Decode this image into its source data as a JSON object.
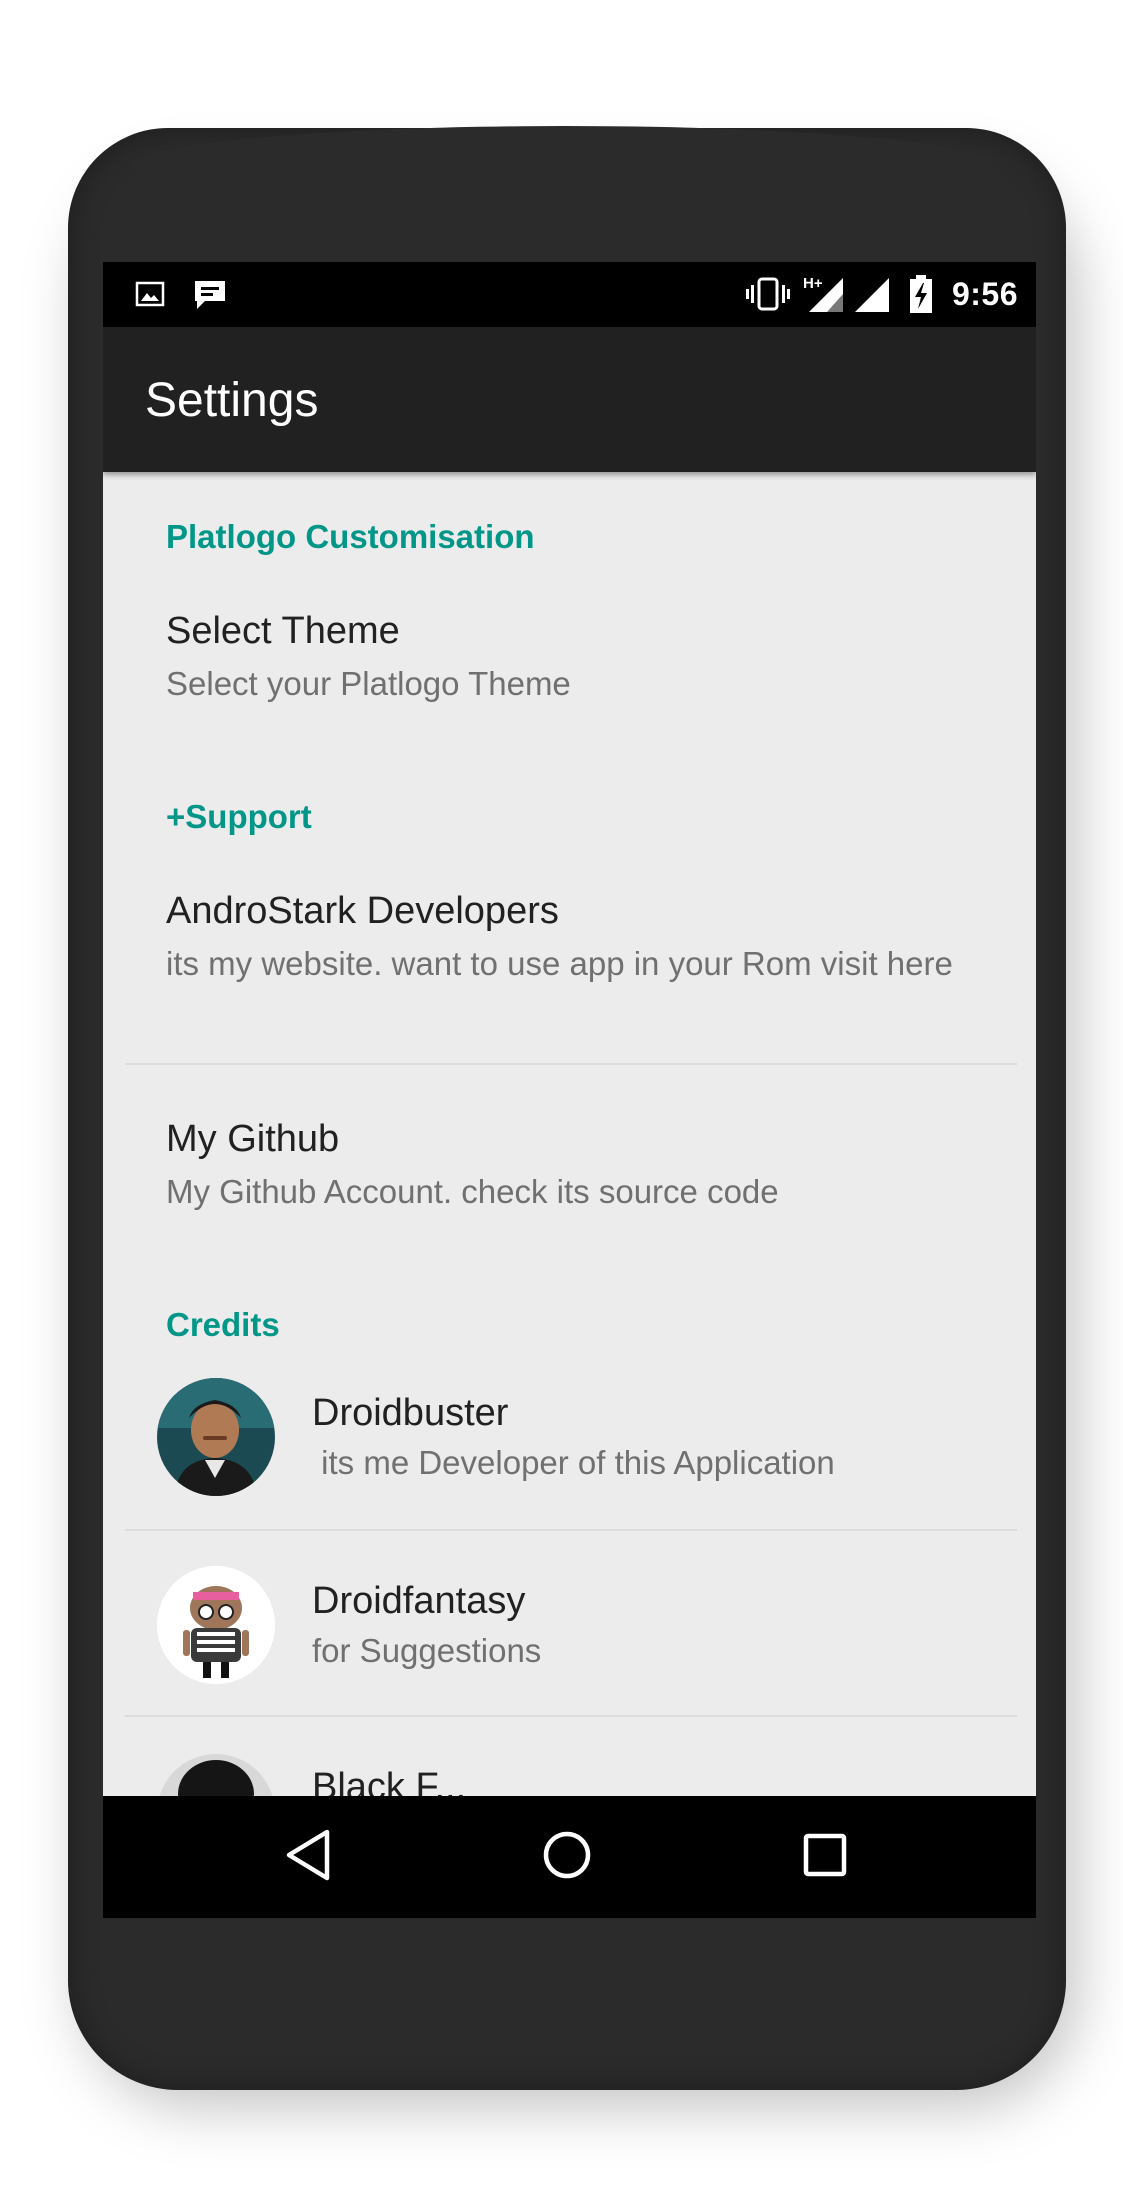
{
  "status_bar": {
    "time": "9:56",
    "left_icons": [
      "image-icon",
      "chat-icon"
    ],
    "right_icons": [
      "vibrate-icon",
      "signal-hplus-icon",
      "signal-icon",
      "battery-charging-icon"
    ]
  },
  "app_bar": {
    "title": "Settings"
  },
  "sections": {
    "customisation": {
      "header": "Platlogo Customisation",
      "items": [
        {
          "title": "Select Theme",
          "summary": "Select your Platlogo Theme"
        }
      ]
    },
    "support": {
      "header": "+Support",
      "items": [
        {
          "title": "AndroStark Developers",
          "summary": "its my website. want to use app in your Rom visit here"
        },
        {
          "title": "My Github",
          "summary": "My Github Account. check its source code"
        }
      ]
    },
    "credits": {
      "header": "Credits",
      "items": [
        {
          "title": "Droidbuster",
          "summary": " its me Developer of this Application",
          "avatar": "person-photo"
        },
        {
          "title": "Droidfantasy",
          "summary": "for Suggestions",
          "avatar": "android-robot-avatar"
        },
        {
          "title": "Black F...",
          "summary": "",
          "avatar": "person-photo"
        }
      ]
    }
  },
  "nav_bar": {
    "icons": [
      "back-icon",
      "home-icon",
      "recents-icon"
    ]
  },
  "colors": {
    "accent": "#009688",
    "app_bar": "#212121",
    "background": "#ececec",
    "status_bar": "#000000"
  }
}
